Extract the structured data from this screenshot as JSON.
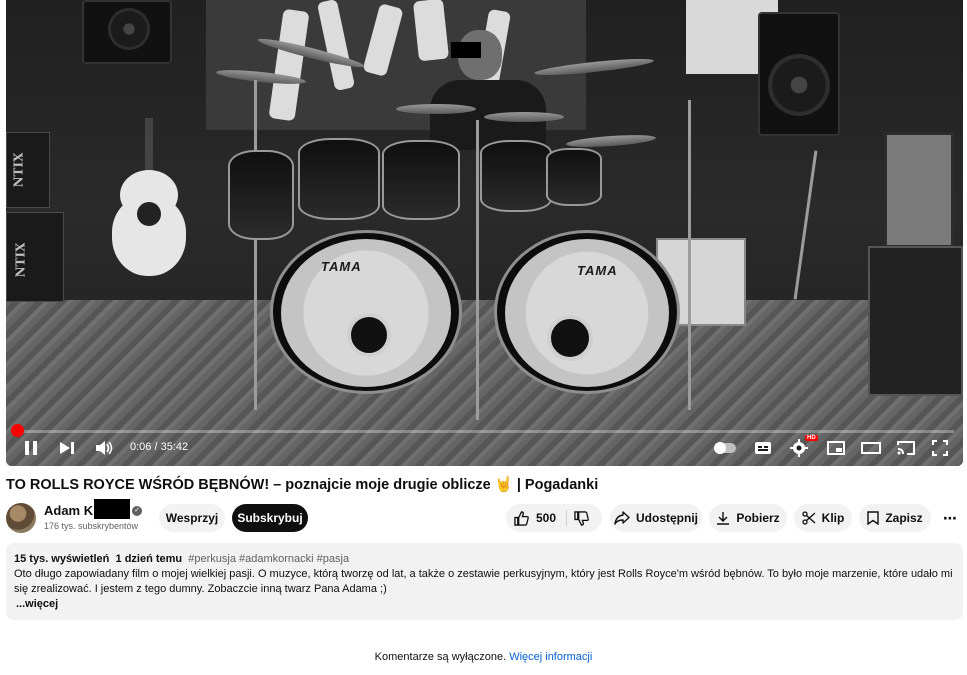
{
  "player": {
    "time_current": "0:06",
    "time_separator": "/",
    "time_total": "35:42",
    "progress_fraction": 0.003,
    "hd_badge": "HD",
    "drum_brand_left": "TAMA",
    "drum_brand_right": "TAMA",
    "icons": {
      "play_pause": "pause-icon",
      "next": "next-icon",
      "volume": "volume-icon",
      "autoplay": "autoplay-toggle",
      "captions": "captions-icon",
      "settings": "gear-icon",
      "miniplayer": "miniplayer-icon",
      "theater": "theater-icon",
      "cast": "cast-icon",
      "fullscreen": "fullscreen-icon"
    }
  },
  "video": {
    "title": "TO ROLLS ROYCE WŚRÓD BĘBNÓW! – poznajcie moje drugie oblicze 🤘 | Pogadanki"
  },
  "channel": {
    "name": "Adam K",
    "subscribers": "176 tys. subskrybentów",
    "support_label": "Wesprzyj",
    "subscribe_label": "Subskrybuj"
  },
  "actions": {
    "likes": "500",
    "share_label": "Udostępnij",
    "download_label": "Pobierz",
    "clip_label": "Klip",
    "save_label": "Zapisz",
    "more_label": "⋯"
  },
  "description": {
    "views": "15 tys. wyświetleń",
    "date": "1 dzień temu",
    "tags": "#perkusja #adamkornacki #pasja",
    "text": "Oto długo zapowiadany film o mojej wielkiej pasji. O muzyce, którą tworzę od lat, a także o zestawie perkusyjnym, który jest Rolls Royce'm wśród bębnów. To było moje marzenie, które udało mi się zrealizować. I jestem z tego dumny. Zobaczcie inną twarz Pana Adama ;)",
    "more_label": "...więcej"
  },
  "comments": {
    "disabled_text": "Komentarze są wyłączone.",
    "info_link": "Więcej informacji"
  },
  "colors": {
    "progress": "#ff0000",
    "link": "#065fd4",
    "pill_bg": "#f2f2f2",
    "subscribe_bg": "#0f0f0f"
  }
}
